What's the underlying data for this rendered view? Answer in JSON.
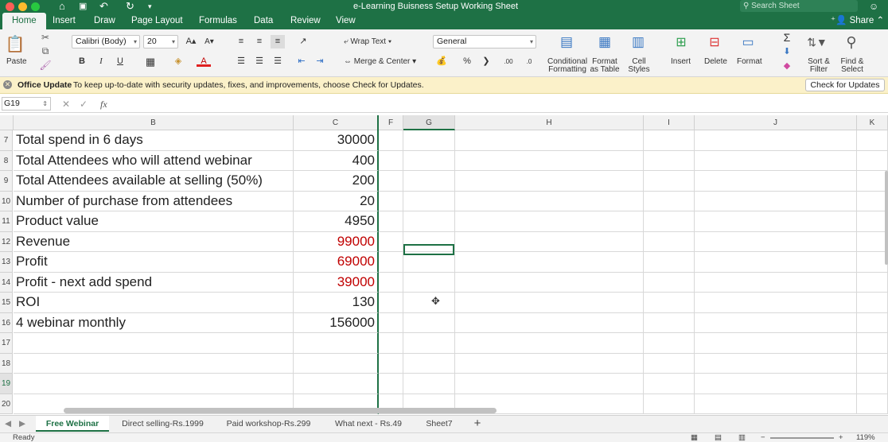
{
  "window": {
    "title": "e-Learning Buisness Setup Working Sheet",
    "search_placeholder": "Search Sheet",
    "share_label": "Share"
  },
  "menu_tabs": [
    "Home",
    "Insert",
    "Draw",
    "Page Layout",
    "Formulas",
    "Data",
    "Review",
    "View"
  ],
  "ribbon": {
    "paste": "Paste",
    "font_name": "Calibri (Body)",
    "font_size": "20",
    "wrap_text": "Wrap Text",
    "merge_center": "Merge & Center",
    "number_format": "General",
    "conditional_formatting": [
      "Conditional",
      "Formatting"
    ],
    "format_as_table": [
      "Format",
      "as Table"
    ],
    "cell_styles": [
      "Cell",
      "Styles"
    ],
    "insert": "Insert",
    "delete": "Delete",
    "format": "Format",
    "sort_filter": [
      "Sort &",
      "Filter"
    ],
    "find_select": [
      "Find &",
      "Select"
    ]
  },
  "notification": {
    "title": "Office Update",
    "message": "To keep up-to-date with security updates, fixes, and improvements, choose Check for Updates.",
    "button": "Check for Updates"
  },
  "formula_bar": {
    "name_box": "G19",
    "fx": "fx",
    "content": ""
  },
  "columns": [
    "B",
    "C",
    "F",
    "G",
    "H",
    "I",
    "J",
    "K"
  ],
  "rows": [
    {
      "num": "7",
      "label": "Total spend in 6 days",
      "value": "30000",
      "red": false
    },
    {
      "num": "8",
      "label": "Total Attendees who will attend webinar",
      "value": "400",
      "red": false
    },
    {
      "num": "9",
      "label": "Total Attendees available at selling (50%)",
      "value": "200",
      "red": false
    },
    {
      "num": "10",
      "label": "Number of purchase from attendees",
      "value": "20",
      "red": false
    },
    {
      "num": "11",
      "label": "Product value",
      "value": "4950",
      "red": false
    },
    {
      "num": "12",
      "label": "Revenue",
      "value": "99000",
      "red": true
    },
    {
      "num": "13",
      "label": "Profit",
      "value": "69000",
      "red": true
    },
    {
      "num": "14",
      "label": "Profit - next add spend",
      "value": "39000",
      "red": true
    },
    {
      "num": "15",
      "label": "ROI",
      "value": "130",
      "red": false
    },
    {
      "num": "16",
      "label": "4 webinar monthly",
      "value": "156000",
      "red": false
    },
    {
      "num": "17",
      "label": "",
      "value": "",
      "red": false
    },
    {
      "num": "18",
      "label": "",
      "value": "",
      "red": false
    },
    {
      "num": "19",
      "label": "",
      "value": "",
      "red": false
    },
    {
      "num": "20",
      "label": "",
      "value": "",
      "red": false
    }
  ],
  "sheet_tabs": [
    "Free Webinar",
    "Direct selling-Rs.1999",
    "Paid workshop-Rs.299",
    "What next - Rs.49",
    "Sheet7"
  ],
  "status": {
    "text": "Ready",
    "zoom": "119%"
  },
  "colors": {
    "accent": "#1e7145",
    "red_value": "#c00000"
  }
}
